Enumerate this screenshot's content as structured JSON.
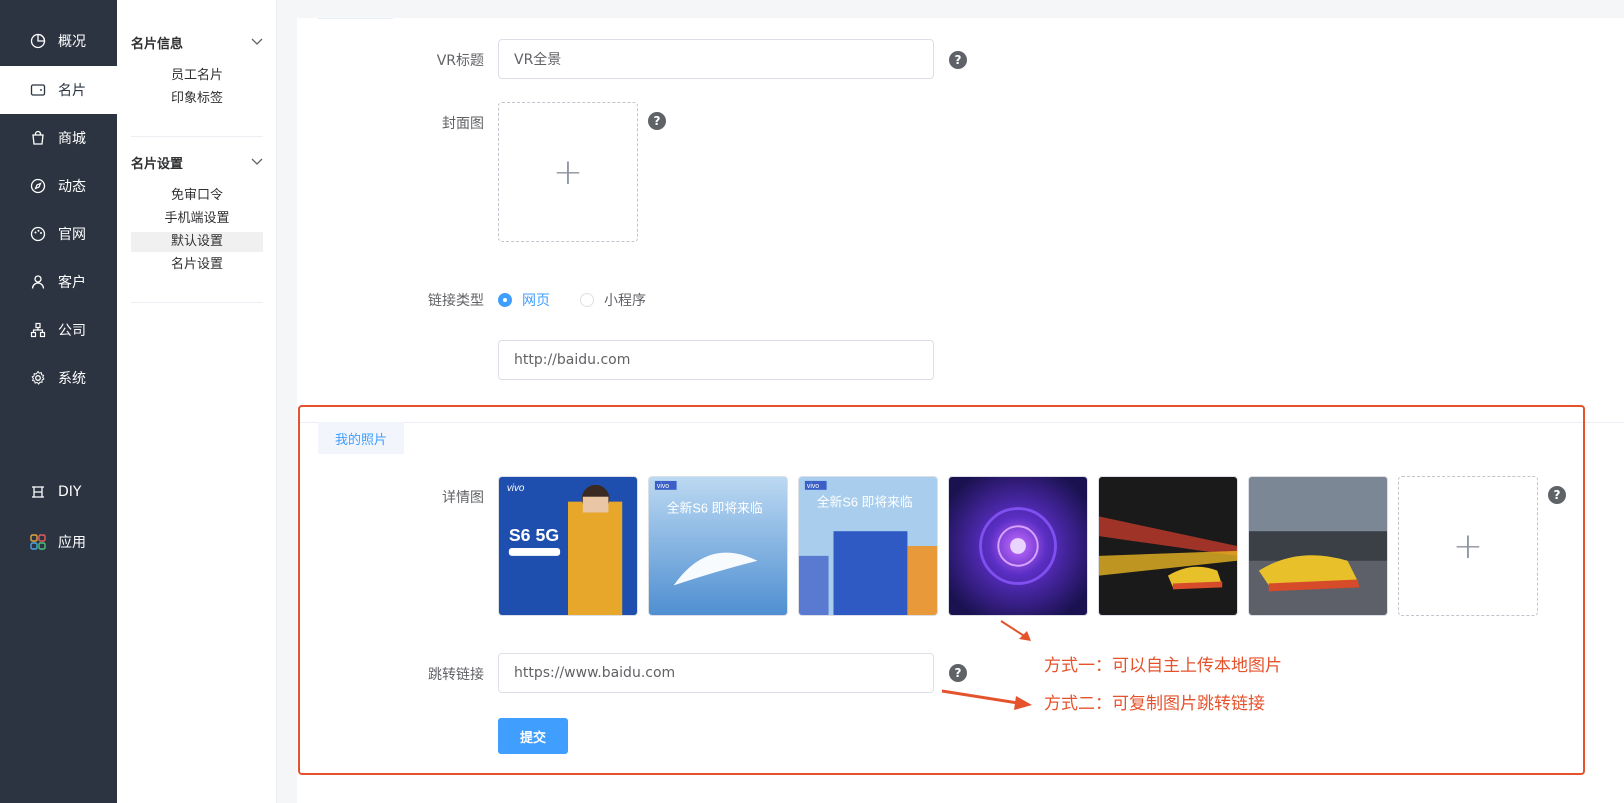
{
  "nav": {
    "items": [
      {
        "label": "概况",
        "icon": "pie-chart-icon"
      },
      {
        "label": "名片",
        "icon": "card-wallet-icon"
      },
      {
        "label": "商城",
        "icon": "shopping-bag-icon"
      },
      {
        "label": "动态",
        "icon": "compass-icon"
      },
      {
        "label": "官网",
        "icon": "palette-icon"
      },
      {
        "label": "客户",
        "icon": "user-icon"
      },
      {
        "label": "公司",
        "icon": "org-chart-icon"
      },
      {
        "label": "系统",
        "icon": "gear-icon"
      }
    ],
    "diy": {
      "label": "DIY",
      "icon": "diy-icon"
    },
    "apps": {
      "label": "应用",
      "icon": "apps-grid-icon"
    }
  },
  "submenu": {
    "group1": {
      "title": "名片信息",
      "items": [
        "员工名片",
        "印象标签"
      ]
    },
    "group2": {
      "title": "名片设置",
      "items": [
        "免审口令",
        "手机端设置",
        "默认设置",
        "名片设置"
      ]
    }
  },
  "form": {
    "vr_title_label": "VR标题",
    "vr_title_value": "VR全景",
    "cover_label": "封面图",
    "link_type_label": "链接类型",
    "link_type_options": [
      "网页",
      "小程序"
    ],
    "link_type_selected": "网页",
    "url_value": "http://baidu.com",
    "section_tab": "我的照片",
    "detail_label": "详情图",
    "jump_label": "跳转链接",
    "jump_value": "https://www.baidu.com",
    "submit_label": "提交",
    "help_glyph": "?",
    "plus_glyph": "+"
  },
  "thumbnails": [
    {
      "name": "vivo-s6-yellow-poster",
      "caption": "S6 5G",
      "brand": "vivo"
    },
    {
      "name": "vivo-s6-feather-poster",
      "caption": "全新S6 即将来临",
      "brand": "vivo"
    },
    {
      "name": "vivo-s6-building-poster",
      "caption": "全新S6 即将来临",
      "brand": "vivo"
    },
    {
      "name": "purple-vortex-image",
      "caption": "",
      "brand": ""
    },
    {
      "name": "running-shoe-motion-image",
      "caption": "",
      "brand": ""
    },
    {
      "name": "running-shoe-city-image",
      "caption": "",
      "brand": ""
    }
  ],
  "annotations": {
    "note1": "方式一：可以自主上传本地图片",
    "note2": "方式二：可复制图片跳转链接"
  },
  "colors": {
    "nav_bg": "#2b3440",
    "accent": "#409eff",
    "annotation": "#e5532d"
  }
}
